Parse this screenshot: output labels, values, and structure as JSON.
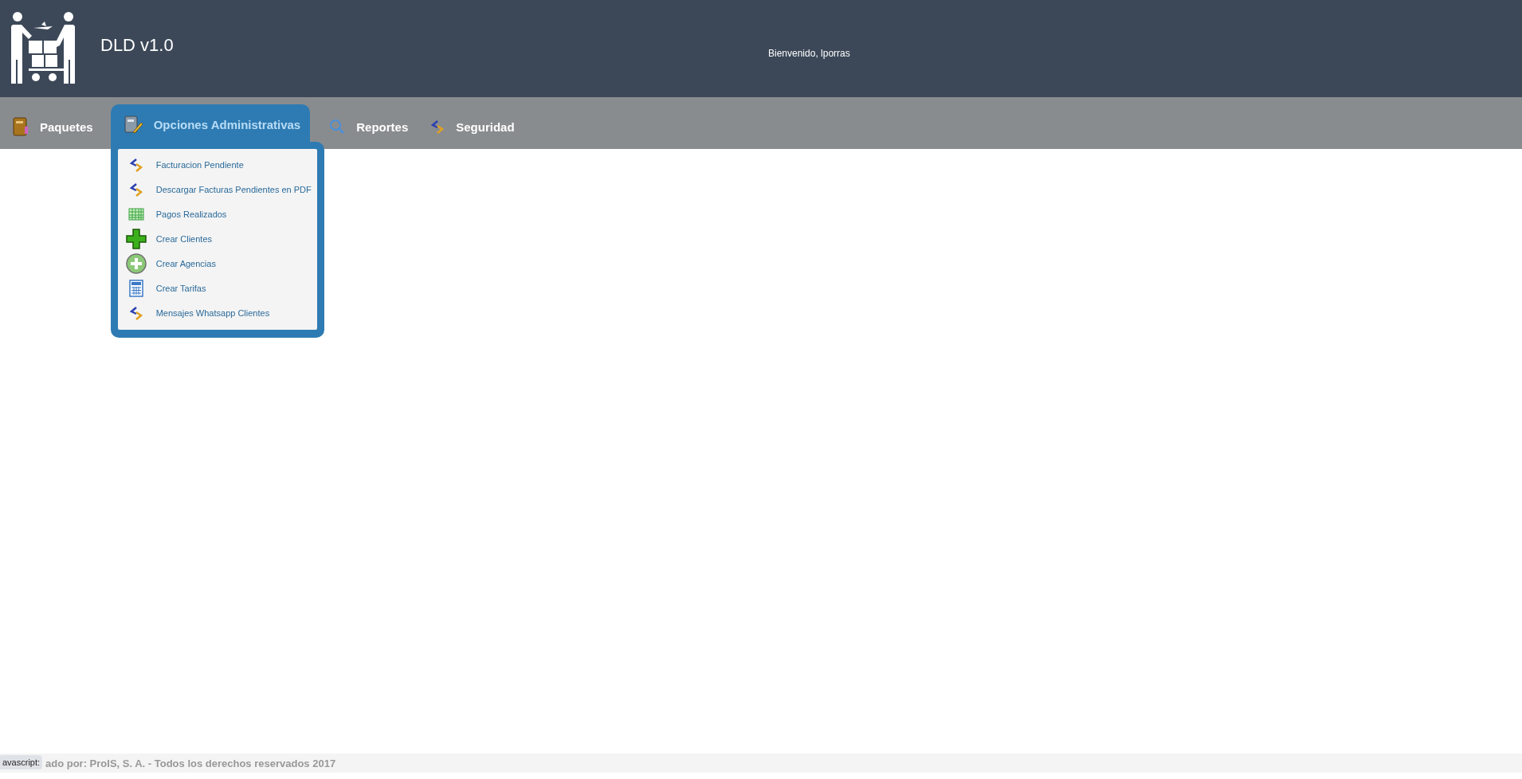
{
  "header": {
    "title": "DLD v1.0",
    "welcome": "Bienvenido, lporras"
  },
  "nav": [
    {
      "label": "Paquetes",
      "kind": "book",
      "selected": false
    },
    {
      "label": "Opciones Administrativas",
      "kind": "notebook",
      "selected": true
    },
    {
      "label": "Reportes",
      "kind": "search",
      "selected": false
    },
    {
      "label": "Seguridad",
      "kind": "arrows",
      "selected": false
    }
  ],
  "menu": [
    {
      "label": "Facturacion Pendiente",
      "kind": "arrows"
    },
    {
      "label": "Descargar Facturas Pendientes en PDF",
      "kind": "arrows"
    },
    {
      "label": "Pagos Realizados",
      "kind": "grid"
    },
    {
      "label": "Crear Clientes",
      "kind": "plus"
    },
    {
      "label": "Crear Agencias",
      "kind": "circle-plus"
    },
    {
      "label": "Crear Tarifas",
      "kind": "calculator"
    },
    {
      "label": "Mensajes Whatsapp Clientes",
      "kind": "arrows"
    }
  ],
  "footer": {
    "text": "ado por: ProIS, S. A. - Todos los derechos reservados 2017"
  },
  "status_tooltip": "avascript:"
}
